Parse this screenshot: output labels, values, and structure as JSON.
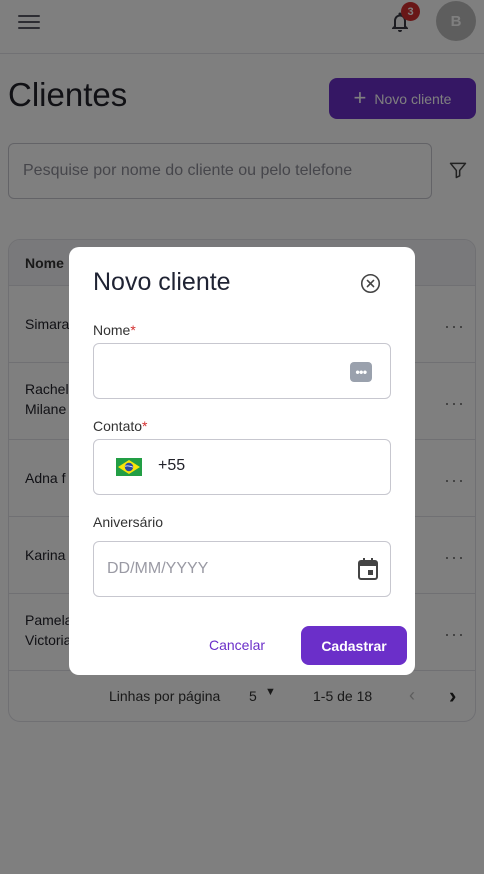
{
  "header": {
    "notification_count": "3",
    "avatar_initial": "B",
    "icons": [
      "menu-icon",
      "bell-icon"
    ]
  },
  "page": {
    "title": "Clientes",
    "new_button_label": "Novo cliente"
  },
  "search": {
    "placeholder": "Pesquise por nome do cliente ou pelo telefone"
  },
  "table": {
    "column_name": "Nome",
    "rows": [
      {
        "name": "Simara"
      },
      {
        "name": "Rachel Milane"
      },
      {
        "name": "Adna f"
      },
      {
        "name": "Karina"
      },
      {
        "name": "Pamela Victoria"
      }
    ],
    "pagination": {
      "rows_per_page_label": "Linhas por página",
      "rows_per_page_value": "5",
      "range": "1-5 de 18"
    }
  },
  "modal": {
    "title": "Novo cliente",
    "name_label": "Nome",
    "contact_label": "Contato",
    "phone_code": "+55",
    "birthday_label": "Aniversário",
    "birthday_placeholder": "DD/MM/YYYY",
    "required_mark": "*",
    "cancel_label": "Cancelar",
    "submit_label": "Cadastrar"
  },
  "colors": {
    "primary": "#6b2fc9",
    "required": "#d32f2f",
    "badge": "#d32f2f"
  }
}
